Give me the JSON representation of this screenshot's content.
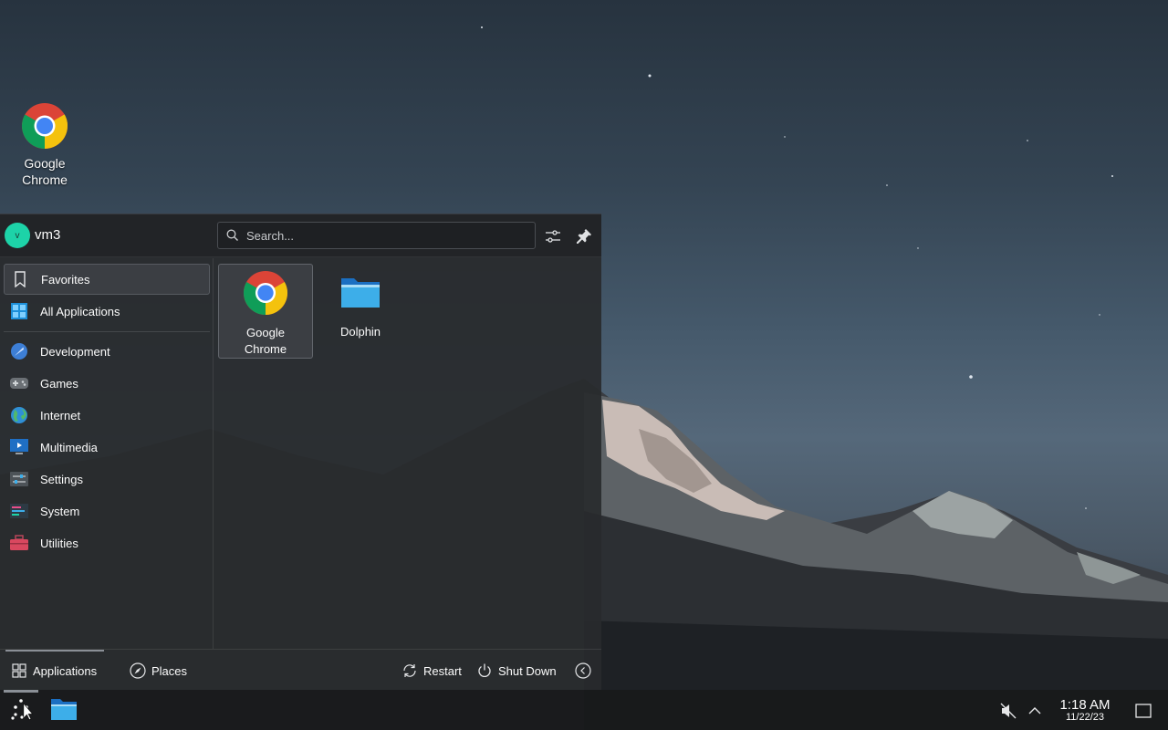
{
  "desktop": {
    "icons": [
      {
        "label": "Google Chrome",
        "icon": "chrome-icon"
      }
    ]
  },
  "launcher": {
    "user": {
      "name": "vm3",
      "avatar_letter": "v"
    },
    "search": {
      "placeholder": "Search..."
    },
    "header_buttons": [
      {
        "icon": "sliders-icon"
      },
      {
        "icon": "pin-icon"
      }
    ],
    "categories": [
      {
        "label": "Favorites",
        "icon": "bookmark-icon",
        "active": true
      },
      {
        "label": "All Applications",
        "icon": "grid-icon"
      },
      {
        "label": "Development",
        "icon": "development-icon"
      },
      {
        "label": "Games",
        "icon": "gamepad-icon"
      },
      {
        "label": "Internet",
        "icon": "globe-icon"
      },
      {
        "label": "Multimedia",
        "icon": "multimedia-icon"
      },
      {
        "label": "Settings",
        "icon": "settings-icon"
      },
      {
        "label": "System",
        "icon": "system-icon"
      },
      {
        "label": "Utilities",
        "icon": "toolbox-icon"
      }
    ],
    "apps": [
      {
        "label": "Google Chrome",
        "icon": "chrome-icon",
        "active": true
      },
      {
        "label": "Dolphin",
        "icon": "folder-icon"
      }
    ],
    "footer": {
      "tabs": [
        {
          "label": "Applications",
          "icon": "apps-grid-icon"
        },
        {
          "label": "Places",
          "icon": "compass-icon"
        }
      ],
      "actions": [
        {
          "label": "Restart",
          "icon": "restart-icon"
        },
        {
          "label": "Shut Down",
          "icon": "power-icon"
        }
      ]
    }
  },
  "taskbar": {
    "clock": {
      "time": "1:18 AM",
      "date": "11/22/23"
    },
    "tray": [
      {
        "icon": "volume-muted-icon"
      },
      {
        "icon": "chevron-up-icon"
      },
      {
        "icon": "show-desktop-icon"
      }
    ]
  },
  "colors": {
    "accent": "#1dd3a8",
    "panel": "#282a2d",
    "selection": "#3b3e43"
  }
}
